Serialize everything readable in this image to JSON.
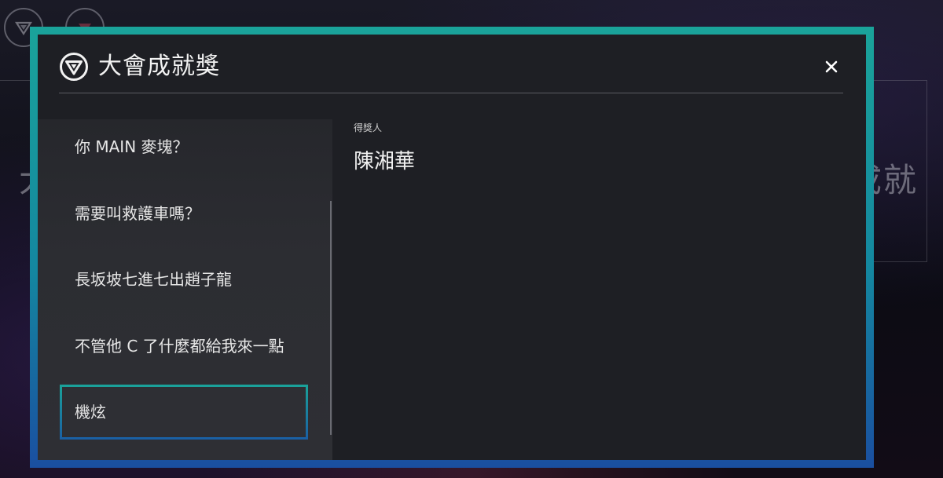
{
  "background": {
    "nav_icons": [
      "brand-logo-icon",
      "menu-icon"
    ],
    "heading_left": "大",
    "heading_right": "成就"
  },
  "modal": {
    "logo_icon": "brand-logo-icon",
    "title": "大會成就獎",
    "close_icon": "close-icon",
    "accent_gradient": [
      "#1aa39a",
      "#1a4fa0"
    ],
    "sidebar": {
      "items": [
        {
          "label": "你 MAIN 麥塊？",
          "active": false
        },
        {
          "label": "需要叫救護車嗎？",
          "active": false
        },
        {
          "label": "長坂坡七進七出趙子龍",
          "active": false
        },
        {
          "label": "不管他 C 了什麼都給我來一點",
          "active": false
        },
        {
          "label": "機炫",
          "active": true
        }
      ]
    },
    "detail": {
      "label": "得獎人",
      "value": "陳湘華"
    }
  }
}
